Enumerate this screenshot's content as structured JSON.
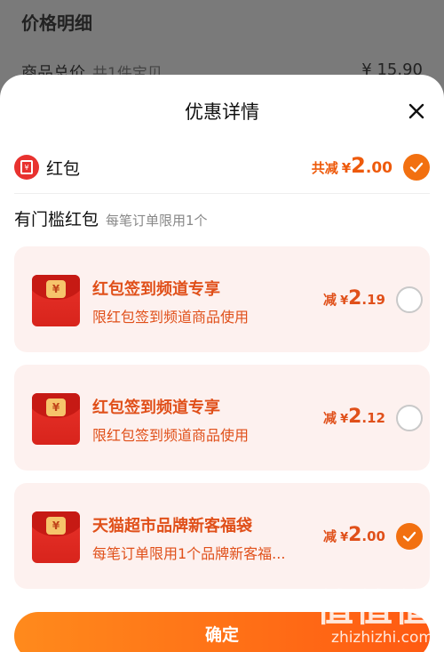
{
  "background": {
    "title": "价格明细",
    "row_label": "商品总价",
    "row_sub": "共1件宝贝",
    "row_price": "¥ 15.90"
  },
  "sheet": {
    "title": "优惠详情",
    "close_icon": "close-icon"
  },
  "hongbao": {
    "label": "红包",
    "total_prefix": "共减",
    "currency": "¥",
    "total_int": "2",
    "total_dec": ".00",
    "checked": true
  },
  "section": {
    "title": "有门槛红包",
    "subtitle": "每笔订单限用1个"
  },
  "coupons": [
    {
      "title": "红包签到频道专享",
      "desc": "限红包签到频道商品使用",
      "prefix": "减",
      "currency": "¥",
      "amt_int": "2",
      "amt_dec": ".19",
      "checked": false
    },
    {
      "title": "红包签到频道专享",
      "desc": "限红包签到频道商品使用",
      "prefix": "减",
      "currency": "¥",
      "amt_int": "2",
      "amt_dec": ".12",
      "checked": false
    },
    {
      "title": "天猫超市品牌新客福袋",
      "desc": "每笔订单限用1个品牌新客福...",
      "prefix": "减",
      "currency": "¥",
      "amt_int": "2",
      "amt_dec": ".00",
      "checked": true
    }
  ],
  "envelope_coin": "¥",
  "confirm_label": "确定",
  "watermark": {
    "big": "值值值",
    "small": "zhizhizhi.com"
  },
  "colors": {
    "accent": "#f27010",
    "coupon_text": "#e0501a",
    "card_bg": "#fdf1ef"
  }
}
